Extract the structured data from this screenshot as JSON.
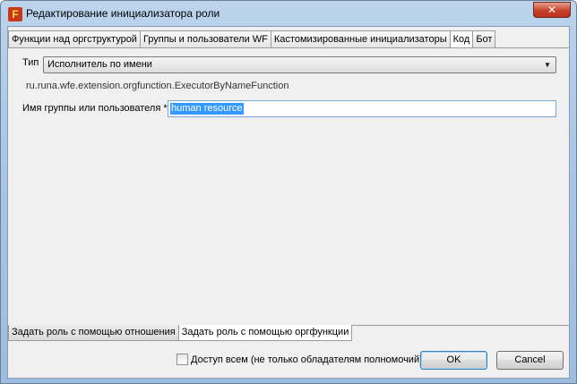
{
  "window": {
    "title": "Редактирование инициализатора роли",
    "icon": "app-logo-icon",
    "close_glyph": "✕"
  },
  "top_tabs": [
    {
      "label": "Функции над оргструктурой",
      "active": false
    },
    {
      "label": "Группы и пользователи WF",
      "active": false
    },
    {
      "label": "Кастомизированные инициализаторы",
      "active": false
    },
    {
      "label": "Код",
      "active": true
    },
    {
      "label": "Бот",
      "active": false
    }
  ],
  "form": {
    "type_label": "Тип",
    "type_value": "Исполнитель по имени",
    "class_name": "ru.runa.wfe.extension.orgfunction.ExecutorByNameFunction",
    "group_label": "Имя группы или пользователя *:",
    "group_value": "human resource"
  },
  "bottom_tabs": [
    {
      "label": "Задать роль с помощью отношения",
      "active": false
    },
    {
      "label": "Задать роль с помощью оргфункции",
      "active": true
    }
  ],
  "footer": {
    "checkbox_label": "Доступ всем (не только обладателям полномочий)",
    "checkbox_checked": false,
    "ok_label": "OK",
    "cancel_label": "Cancel"
  }
}
